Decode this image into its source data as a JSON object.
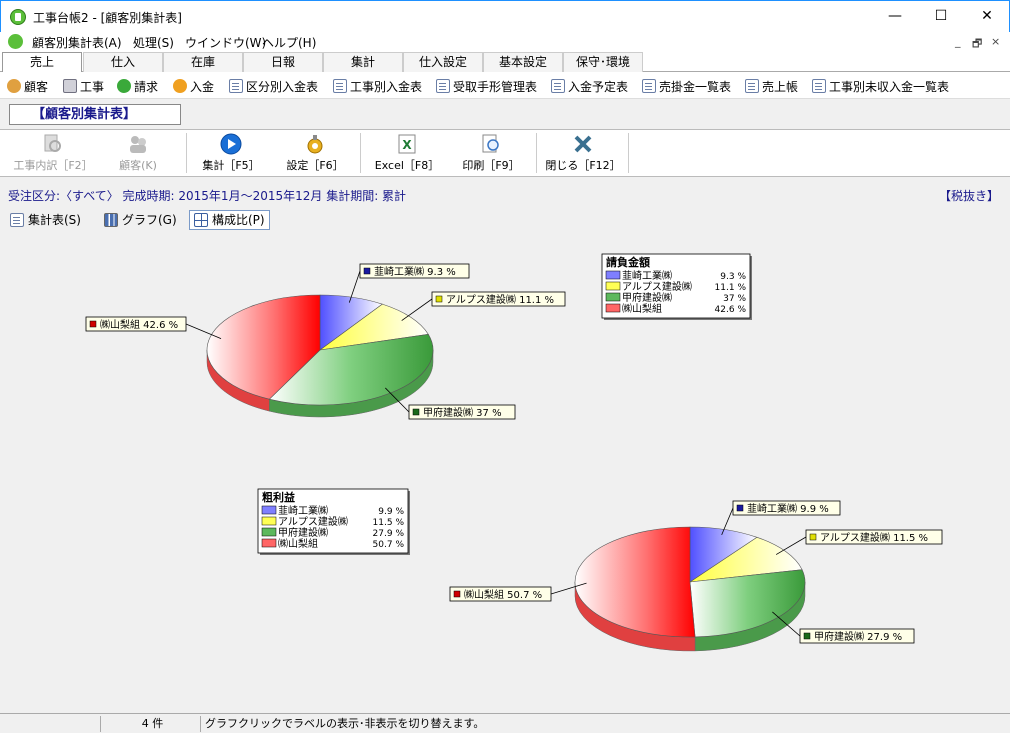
{
  "window": {
    "title": "工事台帳2 - [顧客別集計表]",
    "minimize": "—",
    "maximize": "☐",
    "close": "✕"
  },
  "menubar": {
    "items": [
      "顧客別集計表(A)",
      "処理(S)",
      "ウインドウ(W)",
      "ヘルプ(H)"
    ],
    "mdi": [
      "_",
      "🗗",
      "×"
    ]
  },
  "tabs": [
    "売上",
    "仕入",
    "在庫",
    "日報",
    "集計",
    "仕入設定",
    "基本設定",
    "保守･環境"
  ],
  "quickbar": [
    {
      "label": "顧客",
      "icon": "customers-icon"
    },
    {
      "label": "工事",
      "icon": "house-icon"
    },
    {
      "label": "請求",
      "icon": "dollar-icon"
    },
    {
      "label": "入金",
      "icon": "coin-icon"
    },
    {
      "label": "区分別入金表",
      "icon": "document-icon"
    },
    {
      "label": "工事別入金表",
      "icon": "document-icon"
    },
    {
      "label": "受取手形管理表",
      "icon": "document-icon"
    },
    {
      "label": "入金予定表",
      "icon": "document-icon"
    },
    {
      "label": "売掛金一覧表",
      "icon": "document-icon"
    },
    {
      "label": "売上帳",
      "icon": "document-icon"
    },
    {
      "label": "工事別未収入金一覧表",
      "icon": "document-icon"
    }
  ],
  "page_title": "【顧客別集計表】",
  "toolbar": {
    "detail": "工事内訳［F2］",
    "customer": "顧客(K)",
    "aggregate": "集計［F5］",
    "settings": "設定［F6］",
    "excel": "Excel［F8］",
    "print": "印刷［F9］",
    "close": "閉じる［F12］"
  },
  "info": {
    "text": "受注区分:〈すべて〉 完成時期: 2015年1月～2015年12月 集計期間: 累計",
    "tax": "【税抜き】"
  },
  "viewtabs": {
    "summary": "集計表(S)",
    "graph": "グラフ(G)",
    "ratio": "構成比(P)"
  },
  "colors": {
    "blue": "#7f7fff",
    "yellow": "#ffff55",
    "green": "#5cb85c",
    "red": "#ff6666"
  },
  "chart_data": [
    {
      "type": "pie",
      "title": "請負金額",
      "series": [
        {
          "name": "韮崎工業㈱",
          "value": 9.3,
          "label": "韮崎工業㈱ 9.3 %",
          "legend_value": "9.3 %"
        },
        {
          "name": "アルプス建設㈱",
          "value": 11.1,
          "label": "アルプス建設㈱ 11.1 %",
          "legend_value": "11.1 %"
        },
        {
          "name": "甲府建設㈱",
          "value": 37,
          "label": "甲府建設㈱ 37 %",
          "legend_value": "37 %"
        },
        {
          "name": "㈱山梨組",
          "value": 42.6,
          "label": "㈱山梨組 42.6 %",
          "legend_value": "42.6 %"
        }
      ]
    },
    {
      "type": "pie",
      "title": "粗利益",
      "series": [
        {
          "name": "韮崎工業㈱",
          "value": 9.9,
          "label": "韮崎工業㈱ 9.9 %",
          "legend_value": "9.9 %"
        },
        {
          "name": "アルプス建設㈱",
          "value": 11.5,
          "label": "アルプス建設㈱ 11.5 %",
          "legend_value": "11.5 %"
        },
        {
          "name": "甲府建設㈱",
          "value": 27.9,
          "label": "甲府建設㈱ 27.9 %",
          "legend_value": "27.9 %"
        },
        {
          "name": "㈱山梨組",
          "value": 50.7,
          "label": "㈱山梨組 50.7 %",
          "legend_value": "50.7 %"
        }
      ]
    }
  ],
  "status": {
    "count": "4 件",
    "message": "グラフクリックでラベルの表示･非表示を切り替えます。"
  }
}
